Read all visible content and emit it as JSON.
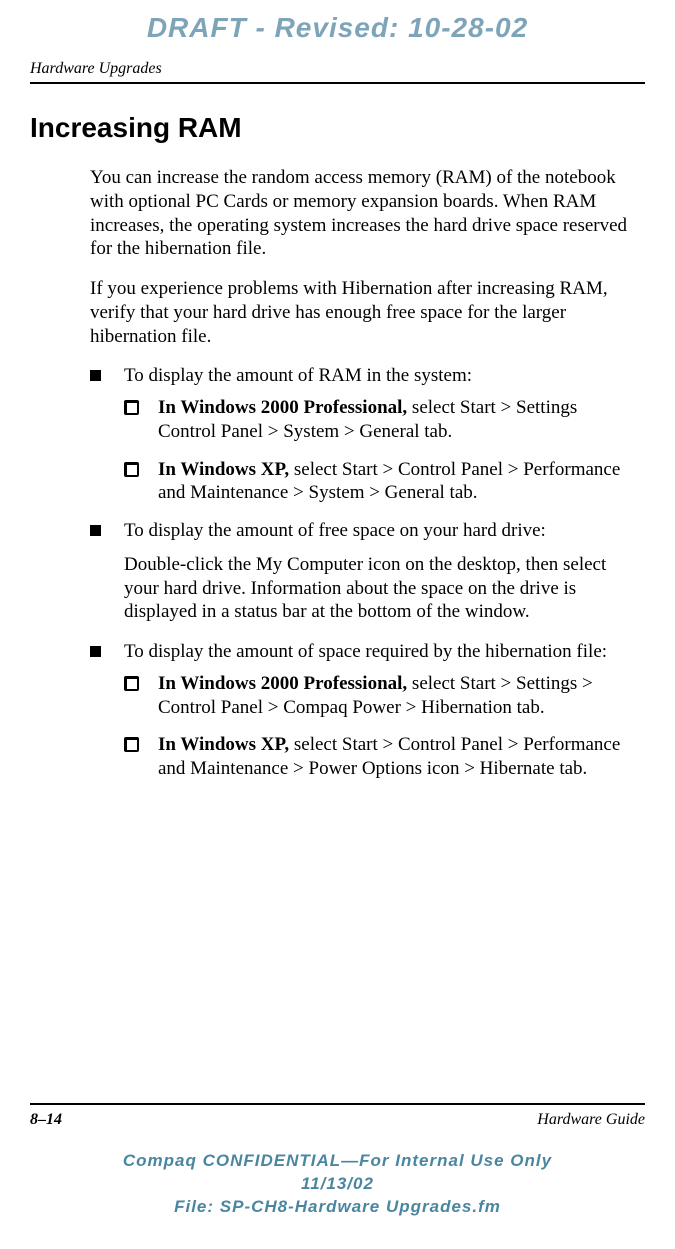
{
  "watermark": "DRAFT - Revised: 10-28-02",
  "header": {
    "section": "Hardware Upgrades"
  },
  "title": "Increasing RAM",
  "p1": "You can increase the random access memory (RAM) of the notebook with optional PC Cards or memory expansion boards. When RAM increases, the operating system increases the hard drive space reserved for the hibernation file.",
  "p2": "If you experience problems with Hibernation after increasing RAM, verify that your hard drive has enough free space for the larger hibernation file.",
  "bullets": [
    {
      "lead": "To display the amount of RAM in the system:",
      "subs": [
        {
          "bold": "In Windows 2000 Professional,",
          "rest": " select Start > Settings Control Panel > System > General tab."
        },
        {
          "bold": "In Windows XP,",
          "rest": " select Start > Control Panel > Performance and Maintenance > System > General tab."
        }
      ]
    },
    {
      "lead": "To display the amount of free space on your hard drive:",
      "para": "Double-click the My Computer icon on the desktop, then select your hard drive. Information about the space on the drive is displayed in a status bar at the bottom of the window."
    },
    {
      "lead": "To display the amount of space required by the hibernation file:",
      "subs": [
        {
          "bold": "In Windows 2000 Professional,",
          "rest": " select Start > Settings > Control Panel > Compaq Power > Hibernation tab."
        },
        {
          "bold": "In Windows XP,",
          "rest": " select Start > Control Panel > Performance and Maintenance > Power Options icon > Hibernate tab."
        }
      ]
    }
  ],
  "footer": {
    "page": "8–14",
    "book": "Hardware Guide"
  },
  "confidential": {
    "l1": "Compaq CONFIDENTIAL—For Internal Use Only",
    "l2": "11/13/02",
    "l3": "File: SP-CH8-Hardware Upgrades.fm"
  }
}
